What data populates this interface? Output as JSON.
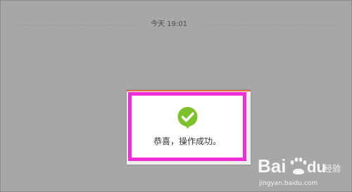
{
  "chat": {
    "timestamp": "今天 19:01"
  },
  "toast": {
    "icon": "check-circle-icon",
    "message": "恭喜，操作成功。",
    "highlight_color": "#ee2ed6",
    "icon_color": "#7dc12a"
  },
  "watermark": {
    "brand": "Bai du 经验",
    "url": "jingyan.baidu.com"
  }
}
